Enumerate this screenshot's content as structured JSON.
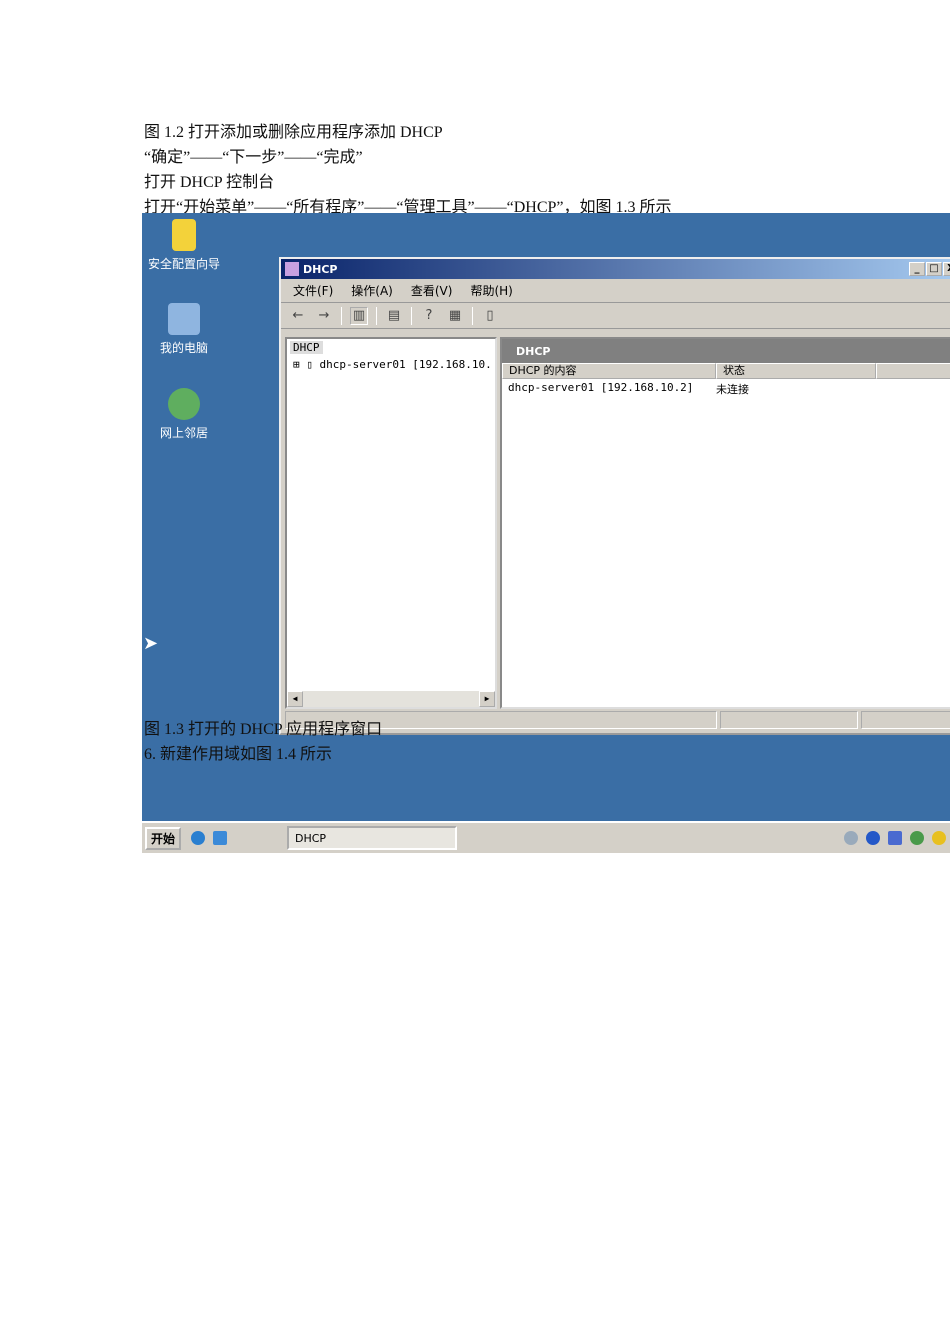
{
  "doc": {
    "lines": [
      "图 1.2 打开添加或删除应用程序添加 DHCP",
      "“确定”——“下一步”——“完成”",
      "打开 DHCP 控制台",
      "打开“开始菜单”——“所有程序”——“管理工具”——“DHCP”，如图 1.3 所示"
    ],
    "caption": "图 1.3 打开的 DHCP 应用程序窗口",
    "step": "6.  新建作用域如图 1.4 所示"
  },
  "desktop": {
    "icons": [
      "安全配置向导",
      "我的电脑",
      "网上邻居"
    ],
    "background": "#3a6ea5"
  },
  "window": {
    "title": "DHCP",
    "controls": [
      "_",
      "□",
      "X"
    ],
    "menu": [
      "文件(F)",
      "操作(A)",
      "查看(V)",
      "帮助(H)"
    ],
    "tree": {
      "root": "DHCP",
      "server": "dhcp-server01 [192.168.10."
    },
    "right": {
      "header": "DHCP",
      "columns": [
        "DHCP 的内容",
        "状态"
      ],
      "rows": [
        {
          "name": "dhcp-server01 [192.168.10.2]",
          "status": "未连接"
        }
      ]
    }
  },
  "taskbar": {
    "start": "开始",
    "task": "DHCP"
  }
}
